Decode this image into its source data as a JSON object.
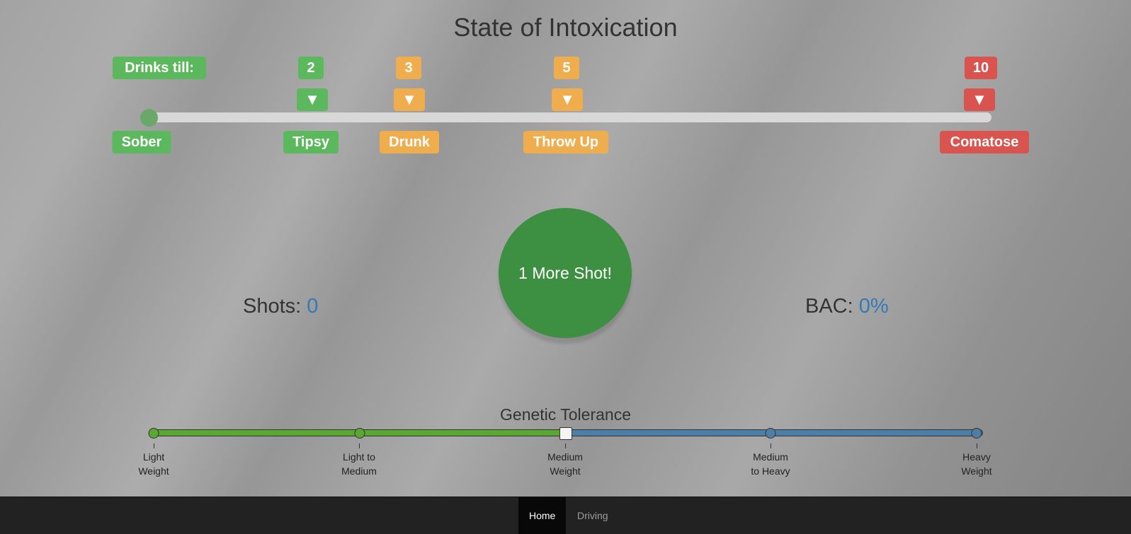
{
  "title": "State of Intoxication",
  "drinks_label": "Drinks till:",
  "markers": [
    {
      "count": "2",
      "state": "Tipsy",
      "color": "green"
    },
    {
      "count": "3",
      "state": "Drunk",
      "color": "orange"
    },
    {
      "count": "5",
      "state": "Throw Up",
      "color": "orange"
    },
    {
      "count": "10",
      "state": "Comatose",
      "color": "red"
    }
  ],
  "start_state": "Sober",
  "arrow_glyph": "▼",
  "intoxication_level": 0,
  "shot_button": "1 More Shot!",
  "stats": {
    "shots_label": "Shots:",
    "shots_value": "0",
    "bac_label": "BAC:",
    "bac_value": "0%"
  },
  "tolerance": {
    "title": "Genetic Tolerance",
    "labels": [
      [
        "Light",
        "Weight"
      ],
      [
        "Light to",
        "Medium"
      ],
      [
        "Medium",
        "Weight"
      ],
      [
        "Medium",
        "to Heavy"
      ],
      [
        "Heavy",
        "Weight"
      ]
    ],
    "selected_index": 2
  },
  "nav": {
    "home": "Home",
    "driving": "Driving"
  },
  "colors": {
    "green": "#5cb85c",
    "orange": "#f0ad4e",
    "red": "#d9534f",
    "shot_button": "#3d8f42",
    "value_blue": "#337ab7",
    "tolerance_green": "#5aa832",
    "tolerance_blue": "#4d7fa6"
  }
}
